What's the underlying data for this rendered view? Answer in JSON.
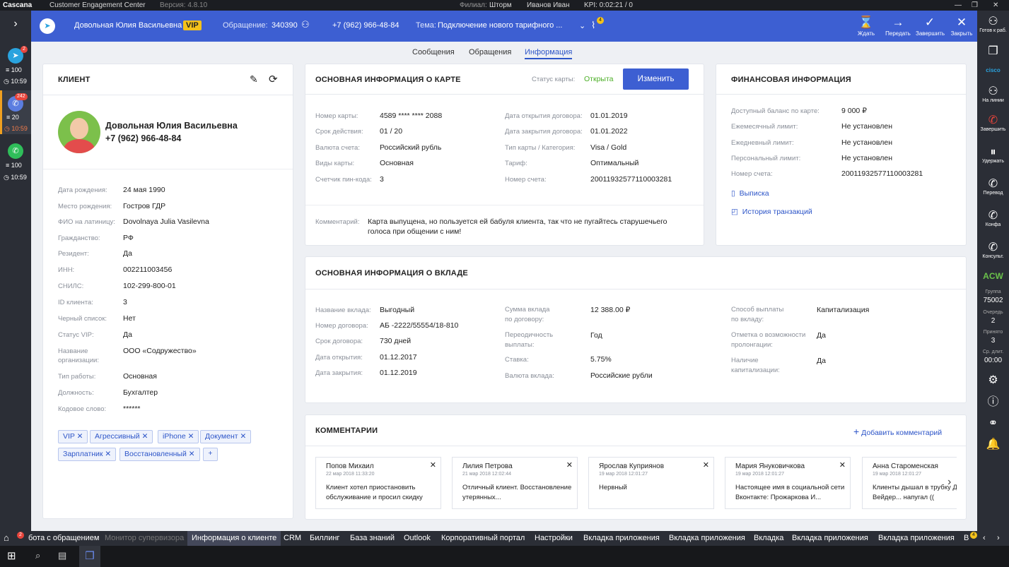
{
  "titlebar": {
    "brand": "Cascana",
    "product": "Customer Engagement Center",
    "version": "Версия: 4.8.10",
    "branch_label": "Филиал:",
    "branch": "Шторм",
    "user": "Иванов Иван",
    "kpi": "KPI: 0:02:21 / 0"
  },
  "leftbar": {
    "items": [
      {
        "badge": "2",
        "count": "100",
        "time": "10:59"
      },
      {
        "badge": "242",
        "count": "20",
        "time": "10:59"
      },
      {
        "count": "100",
        "time": "10:59"
      }
    ]
  },
  "header": {
    "client": "Довольная Юлия Васильевна",
    "vip": "VIP",
    "ticket_label": "Обращение:",
    "ticket": "340390",
    "phone": "+7 (962) 966-48-84",
    "topic_label": "Тема:",
    "topic": "Подключение нового тарифного ...",
    "attach_badge": "4",
    "actions": [
      "Ждать",
      "Передать",
      "Завершить",
      "Закрыть"
    ]
  },
  "tabs": [
    "Сообщения",
    "Обращения",
    "Информация"
  ],
  "client": {
    "title": "КЛИЕНТ",
    "name": "Довольная Юлия Васильевна",
    "phone": "+7 (962) 966-48-84",
    "fields": [
      [
        "Дата рождения:",
        "24 мая 1990"
      ],
      [
        "Место рождения:",
        "Гостров ГДР"
      ],
      [
        "ФИО на латиницу:",
        "Dovolnaya Julia Vasilevna"
      ],
      [
        "Гражданство:",
        "РФ"
      ],
      [
        "Резидент:",
        "Да"
      ],
      [
        "ИНН:",
        "002211003456"
      ],
      [
        "СНИЛС:",
        "102-299-800-01"
      ],
      [
        "ID клиента:",
        "3"
      ],
      [
        "Черный список:",
        "Нет"
      ],
      [
        "Статус VIP:",
        "Да"
      ]
    ],
    "org_label": "Название организации:",
    "org": "ООО «Содружество»",
    "fields2": [
      [
        "Тип работы:",
        "Основная"
      ],
      [
        "Должность:",
        "Бухгалтер"
      ],
      [
        "Кодовое слово:",
        "******"
      ]
    ],
    "tags": [
      "VIP",
      "Агрессивный",
      "iPhone",
      "Документ",
      "Зарплатник",
      "Восстановленный"
    ]
  },
  "card": {
    "title": "ОСНОВНАЯ ИНФОРМАЦИЯ О КАРТЕ",
    "status_label": "Статус карты:",
    "status": "Открыта",
    "change": "Изменить",
    "left": [
      [
        "Номер карты:",
        "4589 **** **** 2088"
      ],
      [
        "Срок действия:",
        "01 / 20"
      ],
      [
        "Валюта счета:",
        "Российский рубль"
      ],
      [
        "Виды карты:",
        "Основная"
      ],
      [
        "Счетчик пин-кода:",
        "3"
      ]
    ],
    "right": [
      [
        "Дата открытия договора:",
        "01.01.2019"
      ],
      [
        "Дата закрытия договора:",
        "01.01.2022"
      ],
      [
        "Тип карты / Категория:",
        "Visa / Gold"
      ],
      [
        "Тариф:",
        "Оптимальный"
      ],
      [
        "Номер счета:",
        "20011932577110003281"
      ]
    ],
    "comment_label": "Комментарий:",
    "comment": "Карта выпущена, но пользуется ей бабуля клиента, так что не пугайтесь старушечьего голоса при общении с ним!"
  },
  "finance": {
    "title": "ФИНАНСОВАЯ ИНФОРМАЦИЯ",
    "rows": [
      [
        "Доступный баланс по карте:",
        "9 000 ₽"
      ],
      [
        "Ежемесячный лимит:",
        "Не установлен"
      ],
      [
        "Ежедневный лимит:",
        "Не установлен"
      ],
      [
        "Персональный лимит:",
        "Не установлен"
      ],
      [
        "Номер счета:",
        "20011932577110003281"
      ]
    ],
    "links": [
      "Выписка",
      "История транзакций"
    ]
  },
  "deposit": {
    "title": "ОСНОВНАЯ ИНФОРМАЦИЯ О ВКЛАДЕ",
    "col1": [
      [
        "Название вклада:",
        "Выгодный"
      ],
      [
        "Номер договора:",
        "АБ -2222/55554/18-810"
      ],
      [
        "Срок договора:",
        "730 дней"
      ],
      [
        "Дата открытия:",
        "01.12.2017"
      ],
      [
        "Дата закрытия:",
        "01.12.2019"
      ]
    ],
    "col2": [
      [
        "Сумма вклада",
        "по договору:",
        "12 388.00 ₽"
      ],
      [
        "Переодичность",
        "выплаты:",
        "Год"
      ],
      [
        "Ставка:",
        "",
        "5.75%"
      ],
      [
        "Валюта вклада:",
        "",
        "Российские рубли"
      ]
    ],
    "col3": [
      [
        "Способ выплаты",
        "по вкладу:",
        "Капитализация"
      ],
      [
        "Отметка о возможности",
        "пролонгации:",
        "Да"
      ],
      [
        "Наличие",
        "капитализации:",
        "Да"
      ]
    ]
  },
  "comments": {
    "title": "КОММЕНТАРИИ",
    "add": "Добавить комментарий",
    "items": [
      {
        "author": "Попов Михаил",
        "date": "22 мар 2018 11:33:20",
        "text": "Клиент хотел приостановить обслуживание и просил скидку"
      },
      {
        "author": "Лилия Петрова",
        "date": "21 мар 2018 12:02:44",
        "text": "Отличный клиент. Восстановление утерянных..."
      },
      {
        "author": "Ярослав Куприянов",
        "date": "19 мар 2018 12:01:27",
        "text": "Нервный"
      },
      {
        "author": "Мария Януковичкова",
        "date": "19 мар 2018 12:01:27",
        "text": "Настоящее имя в социальной сети Вконтакте: Прожаркова И..."
      },
      {
        "author": "Анна Староменская",
        "date": "19 мар 2018 12:01:27",
        "text": "Клиенты дышал в трубку Дарт Вейдер... напугал (("
      }
    ]
  },
  "rightbar": {
    "items": [
      "Готов к раб.",
      "На линии",
      "Завершить",
      "Удержать",
      "Перевод",
      "Конфа",
      "Консульт."
    ],
    "acw": "ACW",
    "stats": [
      [
        "Группа",
        "75002"
      ],
      [
        "Очередь",
        "2"
      ],
      [
        "Принято",
        "3"
      ],
      [
        "Ср. длит.",
        "00:00"
      ]
    ]
  },
  "bottom": {
    "badge": "2",
    "tabs": [
      "бота с обращением",
      "Монитор супервизора",
      "Информация о клиенте",
      "CRM",
      "Биллинг",
      "База знаний",
      "Outlook",
      "Корпоративный портал",
      "Настройки",
      "Вкладка приложения",
      "Вкладка приложения",
      "Вкладка",
      "Вкладка приложения",
      "Вкладка приложения",
      "В"
    ],
    "badge2": "4"
  }
}
